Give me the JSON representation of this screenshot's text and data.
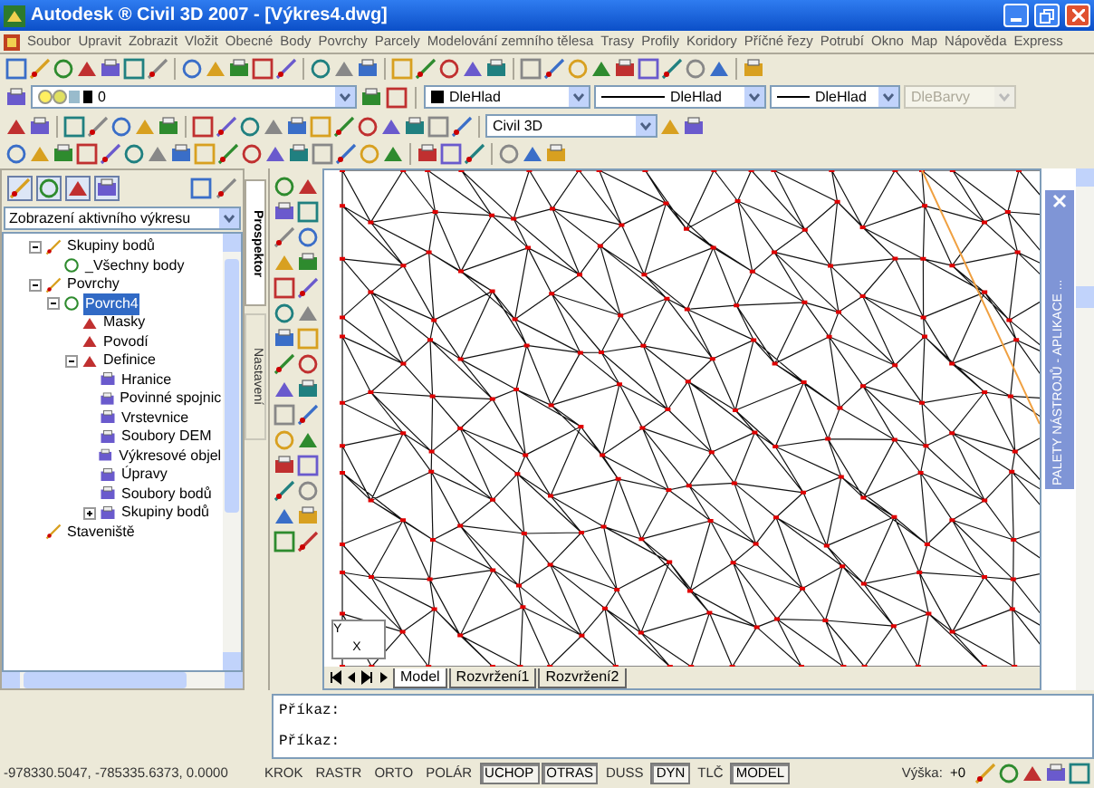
{
  "window": {
    "title": "Autodesk ® Civil 3D 2007 - [Výkres4.dwg]"
  },
  "menu": [
    "Soubor",
    "Upravit",
    "Zobrazit",
    "Vložit",
    "Obecné",
    "Body",
    "Povrchy",
    "Parcely",
    "Modelování zemního tělesa",
    "Trasy",
    "Profily",
    "Koridory",
    "Příčné řezy",
    "Potrubí",
    "Okno",
    "Map",
    "Nápověda",
    "Express"
  ],
  "properties_toolbar": {
    "layer": "0",
    "color_setting": "DleHlad",
    "linetype": "DleHlad",
    "lineweight": "DleHlad",
    "plot_style": {
      "value": "DleBarvy",
      "disabled": true
    }
  },
  "workspace": {
    "value": "Civil 3D"
  },
  "prospector": {
    "view_dropdown": "Zobrazení aktivního výkresu",
    "tree": [
      {
        "label": "Skupiny bodů",
        "expanded": true,
        "selected": false,
        "children": [
          {
            "label": "_Všechny body",
            "selected": false
          }
        ]
      },
      {
        "label": "Povrchy",
        "expanded": true,
        "selected": false,
        "children": [
          {
            "label": "Povrch4",
            "expanded": true,
            "selected": true,
            "children": [
              {
                "label": "Masky",
                "selected": false
              },
              {
                "label": "Povodí",
                "selected": false
              },
              {
                "label": "Definice",
                "expanded": true,
                "selected": false,
                "children": [
                  {
                    "label": "Hranice",
                    "selected": false
                  },
                  {
                    "label": "Povinné spojnic",
                    "selected": false
                  },
                  {
                    "label": "Vrstevnice",
                    "selected": false
                  },
                  {
                    "label": "Soubory DEM",
                    "selected": false
                  },
                  {
                    "label": "Výkresové objel",
                    "selected": false
                  },
                  {
                    "label": "Úpravy",
                    "selected": false
                  },
                  {
                    "label": "Soubory bodů",
                    "selected": false
                  },
                  {
                    "label": "Skupiny bodů",
                    "expanded": false,
                    "selected": false
                  }
                ]
              }
            ]
          }
        ]
      },
      {
        "label": "Staveniště",
        "selected": false
      }
    ]
  },
  "side_tabs": [
    {
      "label": "Prospektor",
      "selected": true
    },
    {
      "label": "Nastavení",
      "selected": false
    }
  ],
  "drawing": {
    "ucs_labels": [
      "Y",
      "X"
    ],
    "layout_tabs": [
      {
        "label": "Model",
        "selected": true
      },
      {
        "label": "Rozvržení1",
        "selected": false
      },
      {
        "label": "Rozvržení2",
        "selected": false
      }
    ]
  },
  "tool_palette": {
    "title": "PALETY NÁSTROJŮ - APLIKACE ..."
  },
  "command_line": [
    "Příkaz:",
    "Příkaz:"
  ],
  "status_bar": {
    "coordinates": "-978330.5047, -785335.6373, 0.0000",
    "toggles": [
      {
        "label": "KROK",
        "on": false
      },
      {
        "label": "RASTR",
        "on": false
      },
      {
        "label": "ORTO",
        "on": false
      },
      {
        "label": "POLÁR",
        "on": false
      },
      {
        "label": "UCHOP",
        "on": true
      },
      {
        "label": "OTRAS",
        "on": true
      },
      {
        "label": "DUSS",
        "on": false
      },
      {
        "label": "DYN",
        "on": true
      },
      {
        "label": "TLČ",
        "on": false
      },
      {
        "label": "MODEL",
        "on": true
      }
    ],
    "elevation_label": "Výška:",
    "elevation": "+0"
  }
}
